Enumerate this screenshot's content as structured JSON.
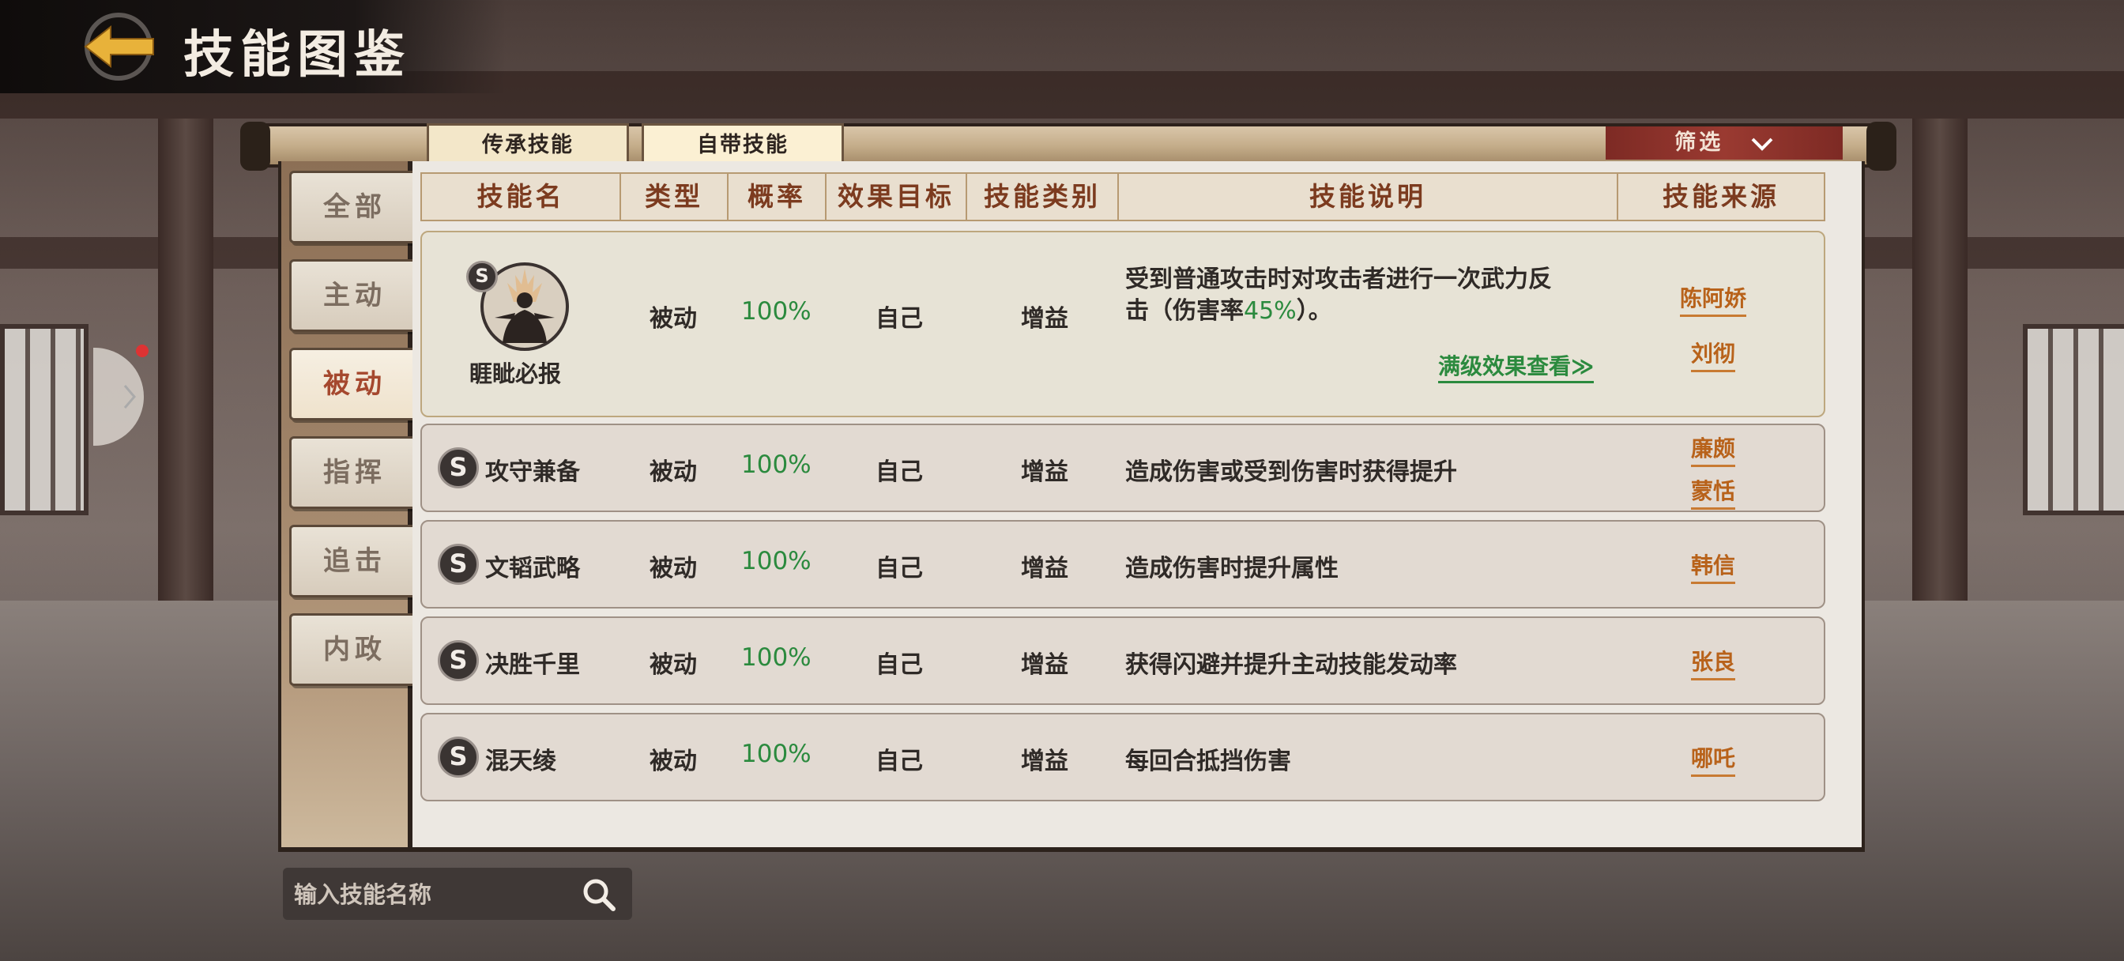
{
  "header": {
    "title": "技能图鉴"
  },
  "tabs": [
    {
      "label": "传承技能",
      "active": false
    },
    {
      "label": "自带技能",
      "active": true
    }
  ],
  "filter": {
    "label": "筛选"
  },
  "categories": [
    {
      "label": "全部",
      "active": false
    },
    {
      "label": "主动",
      "active": false
    },
    {
      "label": "被动",
      "active": true
    },
    {
      "label": "指挥",
      "active": false
    },
    {
      "label": "追击",
      "active": false
    },
    {
      "label": "内政",
      "active": false
    }
  ],
  "table": {
    "columns": [
      "技能名",
      "类型",
      "概率",
      "效果目标",
      "技能类别",
      "技能说明",
      "技能来源"
    ],
    "rows": [
      {
        "grade": "S",
        "name": "睚眦必报",
        "type": "被动",
        "rate": "100%",
        "target": "自己",
        "category": "增益",
        "desc_line1": "受到普通攻击时对攻击者进行一次武力反",
        "desc_line2_pre": "击（伤害率",
        "desc_line2_value": "45%",
        "desc_line2_post": "）。",
        "full_level_link": "满级效果查看≫",
        "sources": [
          "陈阿娇",
          "刘彻"
        ]
      },
      {
        "grade": "S",
        "name": "攻守兼备",
        "type": "被动",
        "rate": "100%",
        "target": "自己",
        "category": "增益",
        "desc": "造成伤害或受到伤害时获得提升",
        "sources": [
          "廉颇",
          "蒙恬"
        ]
      },
      {
        "grade": "S",
        "name": "文韬武略",
        "type": "被动",
        "rate": "100%",
        "target": "自己",
        "category": "增益",
        "desc": "造成伤害时提升属性",
        "sources": [
          "韩信"
        ]
      },
      {
        "grade": "S",
        "name": "决胜千里",
        "type": "被动",
        "rate": "100%",
        "target": "自己",
        "category": "增益",
        "desc": "获得闪避并提升主动技能发动率",
        "sources": [
          "张良"
        ]
      },
      {
        "grade": "S",
        "name": "混天绫",
        "type": "被动",
        "rate": "100%",
        "target": "自己",
        "category": "增益",
        "desc": "每回合抵挡伤害",
        "sources": [
          "哪吒"
        ]
      }
    ]
  },
  "search": {
    "placeholder": "输入技能名称",
    "value": ""
  },
  "icons": {
    "back": "back-arrow-icon",
    "search": "search-icon",
    "filter_toggle": "chevron-down-icon",
    "grade": "s-grade-icon"
  },
  "colors": {
    "rate_green": "#2b8a3e",
    "source_orange": "#b8621a",
    "header_text": "#7c3b1f",
    "active_category": "#a5482e",
    "filter_red": "#9a3a31"
  }
}
